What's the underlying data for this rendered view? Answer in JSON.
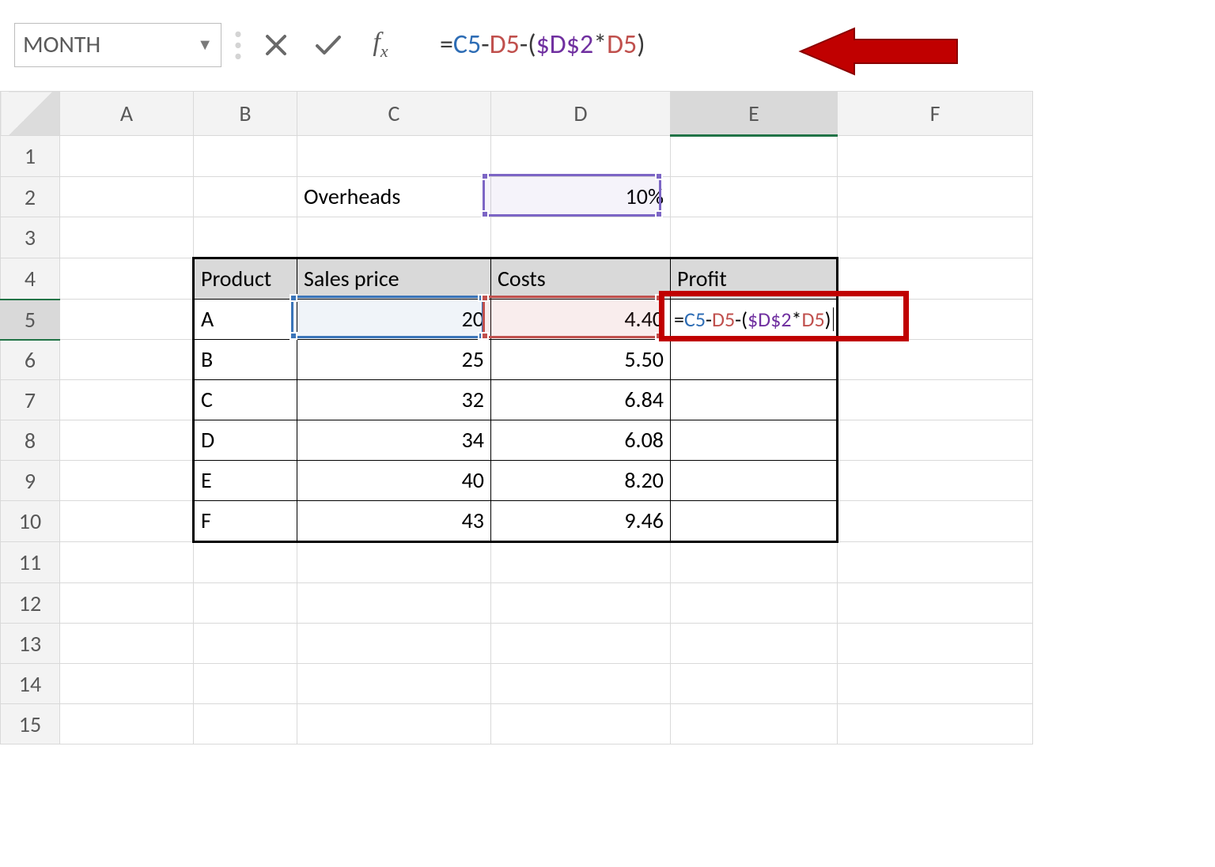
{
  "name_box": "MONTH",
  "formula": {
    "eq": "=",
    "c5": "C5",
    "minus1": "-",
    "d5a": "D5",
    "minus2": "-(",
    "dd2": "$D$2",
    "star": "*",
    "d5b": "D5",
    "close": ")"
  },
  "columns": [
    "A",
    "B",
    "C",
    "D",
    "E",
    "F"
  ],
  "rows": [
    "1",
    "2",
    "3",
    "4",
    "5",
    "6",
    "7",
    "8",
    "9",
    "10",
    "11",
    "12",
    "13",
    "14",
    "15"
  ],
  "overheads_label": "Overheads",
  "overheads_value": "10%",
  "headers": {
    "product": "Product",
    "sales": "Sales price",
    "costs": "Costs",
    "profit": "Profit"
  },
  "data": [
    {
      "product": "A",
      "sales": "20",
      "costs": "4.40"
    },
    {
      "product": "B",
      "sales": "25",
      "costs": "5.50"
    },
    {
      "product": "C",
      "sales": "32",
      "costs": "6.84"
    },
    {
      "product": "D",
      "sales": "34",
      "costs": "6.08"
    },
    {
      "product": "E",
      "sales": "40",
      "costs": "8.20"
    },
    {
      "product": "F",
      "sales": "43",
      "costs": "9.46"
    }
  ],
  "colors": {
    "annotation": "#c00000",
    "purple": "#7c65c5",
    "blue": "#3a74b8",
    "red": "#c0504d",
    "green": "#217346"
  }
}
